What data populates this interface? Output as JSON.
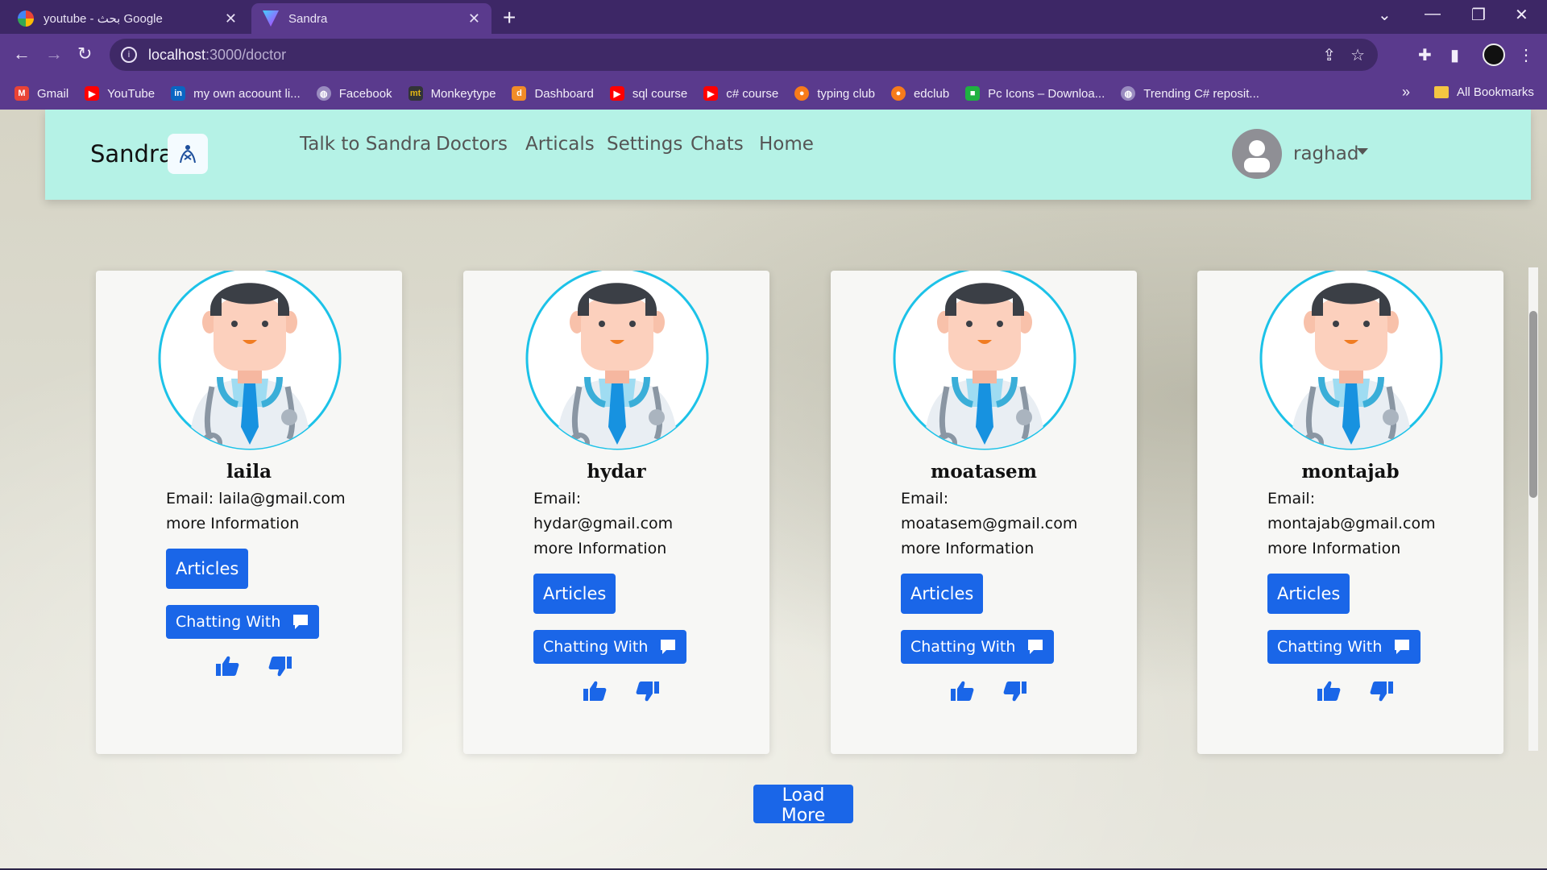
{
  "browser": {
    "tabs": [
      {
        "title": "youtube - بحث Google"
      },
      {
        "title": "Sandra"
      }
    ],
    "url_host": "localhost",
    "url_path": ":3000/doctor",
    "bookmarks": [
      {
        "label": "Gmail",
        "icon": "gmail-icon",
        "color": "#ea4335"
      },
      {
        "label": "YouTube",
        "icon": "youtube-icon",
        "color": "#ff0000"
      },
      {
        "label": "my own acoount li...",
        "icon": "linkedin-icon",
        "color": "#0a66c2"
      },
      {
        "label": "Facebook",
        "icon": "globe-icon",
        "color": "#9a8cc0"
      },
      {
        "label": "Monkeytype",
        "icon": "monkeytype-icon",
        "color": "#e2b714"
      },
      {
        "label": "Dashboard",
        "icon": "dashboard-icon",
        "color": "#f28c28"
      },
      {
        "label": "sql course",
        "icon": "youtube-icon",
        "color": "#ff0000"
      },
      {
        "label": "c# course",
        "icon": "youtube-icon",
        "color": "#ff0000"
      },
      {
        "label": "typing club",
        "icon": "typingclub-icon",
        "color": "#f77b1a"
      },
      {
        "label": "edclub",
        "icon": "edclub-icon",
        "color": "#f77b1a"
      },
      {
        "label": "Pc Icons – Downloa...",
        "icon": "icons8-icon",
        "color": "#1fb141"
      },
      {
        "label": "Trending C# reposit...",
        "icon": "globe-icon",
        "color": "#9a8cc0"
      }
    ],
    "bookmarks_more": "»",
    "all_bookmarks": "All Bookmarks"
  },
  "navbar": {
    "brand": "Sandra",
    "links": [
      "Talk to Sandra",
      "Doctors",
      "Articals",
      "Settings",
      "Chats",
      "Home"
    ],
    "user": "raghad"
  },
  "doctors": [
    {
      "name": "laila",
      "email_lines": [
        "Email: laila@gmail.com"
      ],
      "more": "more Information",
      "articles": "Articles",
      "chat": "Chatting With"
    },
    {
      "name": "hydar",
      "email_lines": [
        "Email:",
        "hydar@gmail.com"
      ],
      "more": "more Information",
      "articles": "Articles",
      "chat": "Chatting With"
    },
    {
      "name": "moatasem",
      "email_lines": [
        "Email:",
        "moatasem@gmail.com"
      ],
      "more": "more Information",
      "articles": "Articles",
      "chat": "Chatting With"
    },
    {
      "name": "montajab",
      "email_lines": [
        "Email:",
        "montajab@gmail.com"
      ],
      "more": "more Information",
      "articles": "Articles",
      "chat": "Chatting With"
    }
  ],
  "load_more": "Load More",
  "colors": {
    "accent": "#1a66e8",
    "navbar": "#b5f2e6",
    "ring": "#1cc2e8"
  }
}
